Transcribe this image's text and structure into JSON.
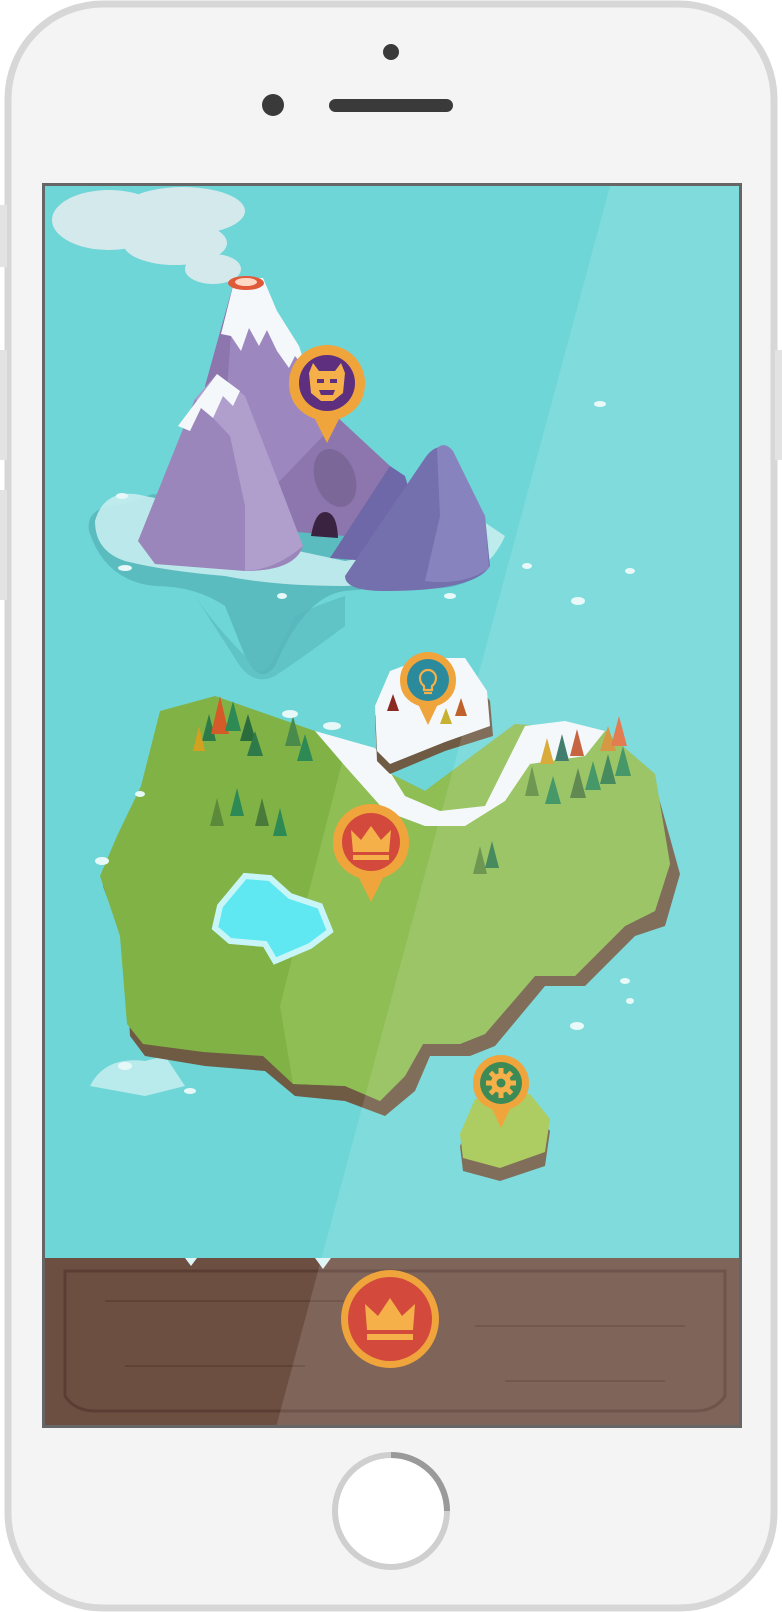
{
  "app": {
    "screen": "world-map"
  },
  "colors": {
    "sea": "#6fd6d8",
    "wood": "#7a5a4c",
    "volcano": "#8e7bb4",
    "grass": "#8bb54a",
    "snow": "#f4f8fb",
    "pin_rim": "#f0a43c",
    "pin_purple": "#5e2f7e",
    "pin_red": "#d34a3c",
    "pin_teal": "#2b8a9c",
    "pin_green": "#3c8a56"
  },
  "map": {
    "locations": [
      {
        "name": "volcano-boss",
        "icon": "monster-face-icon"
      },
      {
        "name": "snow-island",
        "icon": "lightbulb-icon"
      },
      {
        "name": "main-kingdom",
        "icon": "crown-icon"
      },
      {
        "name": "small-island",
        "icon": "gear-icon"
      }
    ]
  },
  "bottom_bar": {
    "button_icon": "crown-icon"
  },
  "device": {
    "type": "phone-frame"
  }
}
